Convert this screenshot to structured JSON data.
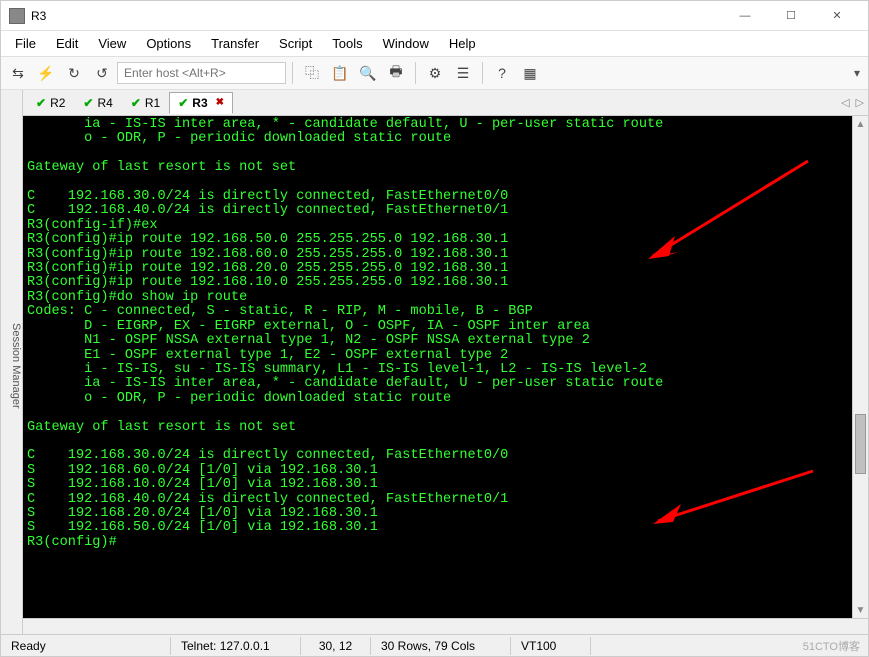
{
  "window": {
    "title": "R3",
    "minimize": "—",
    "maximize": "☐",
    "close": "✕"
  },
  "menu": {
    "file": "File",
    "edit": "Edit",
    "view": "View",
    "options": "Options",
    "transfer": "Transfer",
    "script": "Script",
    "tools": "Tools",
    "window": "Window",
    "help": "Help"
  },
  "toolbar": {
    "host_placeholder": "Enter host <Alt+R>"
  },
  "sidebar": {
    "session_manager": "Session Manager"
  },
  "tabs": {
    "items": [
      {
        "label": "R2",
        "active": false
      },
      {
        "label": "R4",
        "active": false
      },
      {
        "label": "R1",
        "active": false
      },
      {
        "label": "R3",
        "active": true
      }
    ]
  },
  "terminal_lines": [
    "       ia - IS-IS inter area, * - candidate default, U - per-user static route",
    "       o - ODR, P - periodic downloaded static route",
    "",
    "Gateway of last resort is not set",
    "",
    "C    192.168.30.0/24 is directly connected, FastEthernet0/0",
    "C    192.168.40.0/24 is directly connected, FastEthernet0/1",
    "R3(config-if)#ex",
    "R3(config)#ip route 192.168.50.0 255.255.255.0 192.168.30.1",
    "R3(config)#ip route 192.168.60.0 255.255.255.0 192.168.30.1",
    "R3(config)#ip route 192.168.20.0 255.255.255.0 192.168.30.1",
    "R3(config)#ip route 192.168.10.0 255.255.255.0 192.168.30.1",
    "R3(config)#do show ip route",
    "Codes: C - connected, S - static, R - RIP, M - mobile, B - BGP",
    "       D - EIGRP, EX - EIGRP external, O - OSPF, IA - OSPF inter area",
    "       N1 - OSPF NSSA external type 1, N2 - OSPF NSSA external type 2",
    "       E1 - OSPF external type 1, E2 - OSPF external type 2",
    "       i - IS-IS, su - IS-IS summary, L1 - IS-IS level-1, L2 - IS-IS level-2",
    "       ia - IS-IS inter area, * - candidate default, U - per-user static route",
    "       o - ODR, P - periodic downloaded static route",
    "",
    "Gateway of last resort is not set",
    "",
    "C    192.168.30.0/24 is directly connected, FastEthernet0/0",
    "S    192.168.60.0/24 [1/0] via 192.168.30.1",
    "S    192.168.10.0/24 [1/0] via 192.168.30.1",
    "C    192.168.40.0/24 is directly connected, FastEthernet0/1",
    "S    192.168.20.0/24 [1/0] via 192.168.30.1",
    "S    192.168.50.0/24 [1/0] via 192.168.30.1",
    "R3(config)#"
  ],
  "status": {
    "ready": "Ready",
    "conn": "Telnet: 127.0.0.1",
    "cursor": "30,  12",
    "size": "30 Rows, 79 Cols",
    "emu": "VT100",
    "watermark": "51CTO博客"
  }
}
